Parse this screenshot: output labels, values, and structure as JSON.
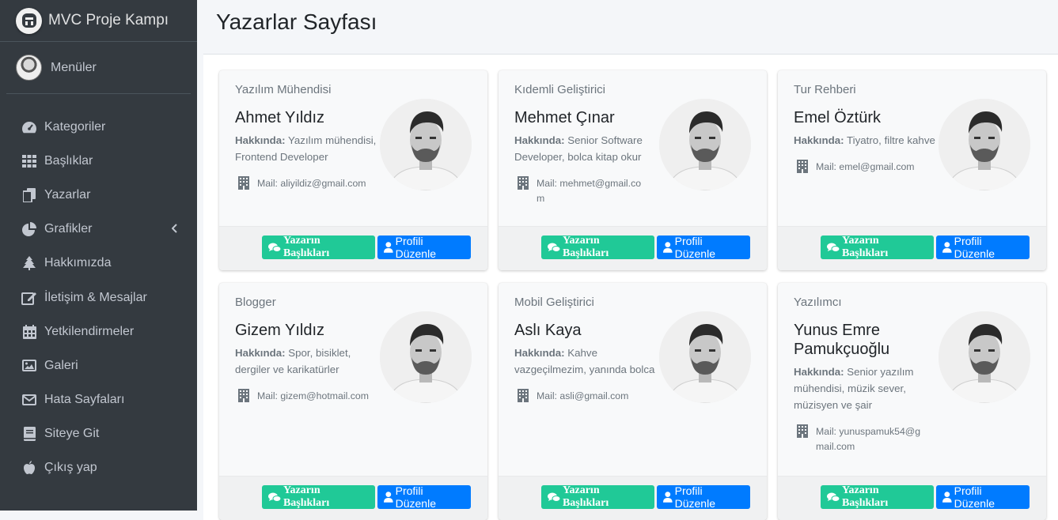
{
  "app": {
    "title": "MVC Proje Kampı"
  },
  "user": {
    "name": "Menüler"
  },
  "sidebar": {
    "items": [
      {
        "label": "Kategoriler",
        "icon": "dashboard-icon"
      },
      {
        "label": "Başlıklar",
        "icon": "grid-icon"
      },
      {
        "label": "Yazarlar",
        "icon": "copy-icon"
      },
      {
        "label": "Grafikler",
        "icon": "pie-chart-icon"
      },
      {
        "label": "Hakkımızda",
        "icon": "tree-icon"
      },
      {
        "label": "İletişim & Mesajlar",
        "icon": "edit-icon"
      },
      {
        "label": "Yetkilendirmeler",
        "icon": "calendar-icon"
      },
      {
        "label": "Galeri",
        "icon": "image-icon"
      },
      {
        "label": "Hata Sayfaları",
        "icon": "envelope-icon"
      },
      {
        "label": "Siteye Git",
        "icon": "book-icon"
      },
      {
        "label": "Çıkış yap",
        "icon": "apple-icon"
      }
    ]
  },
  "page": {
    "title": "Yazarlar Sayfası"
  },
  "labels": {
    "about": "Hakkında:",
    "btn_titles": "Yazarın Başlıkları",
    "btn_edit": "Profili Düzenle"
  },
  "writers": [
    {
      "title": "Yazılım Mühendisi",
      "name": "Ahmet Yıldız",
      "about": "Yazılım mühendisi, Frontend Developer",
      "mail": "Mail: aliyildiz@gmail.com"
    },
    {
      "title": "Kıdemli Geliştirici",
      "name": "Mehmet Çınar",
      "about": "Senior Software Developer, bolca kitap okur",
      "mail": "Mail: mehmet@gmail.com"
    },
    {
      "title": "Tur Rehberi",
      "name": "Emel Öztürk",
      "about": "Tiyatro, filtre kahve",
      "mail": "Mail: emel@gmail.com"
    },
    {
      "title": "Blogger",
      "name": "Gizem Yıldız",
      "about": "Spor, bisiklet, dergiler ve karikatürler",
      "mail": "Mail: gizem@hotmail.com"
    },
    {
      "title": "Mobil Geliştirici",
      "name": "Aslı Kaya",
      "about": "Kahve vazgeçilmezim, yanında bolca",
      "mail": "Mail: asli@gmail.com"
    },
    {
      "title": "Yazılımcı",
      "name": "Yunus Emre Pamukçuoğlu",
      "about": "Senior yazılım mühendisi, müzik sever, müzisyen ve şair",
      "mail": "Mail: yunuspamuk54@gmail.com"
    }
  ]
}
